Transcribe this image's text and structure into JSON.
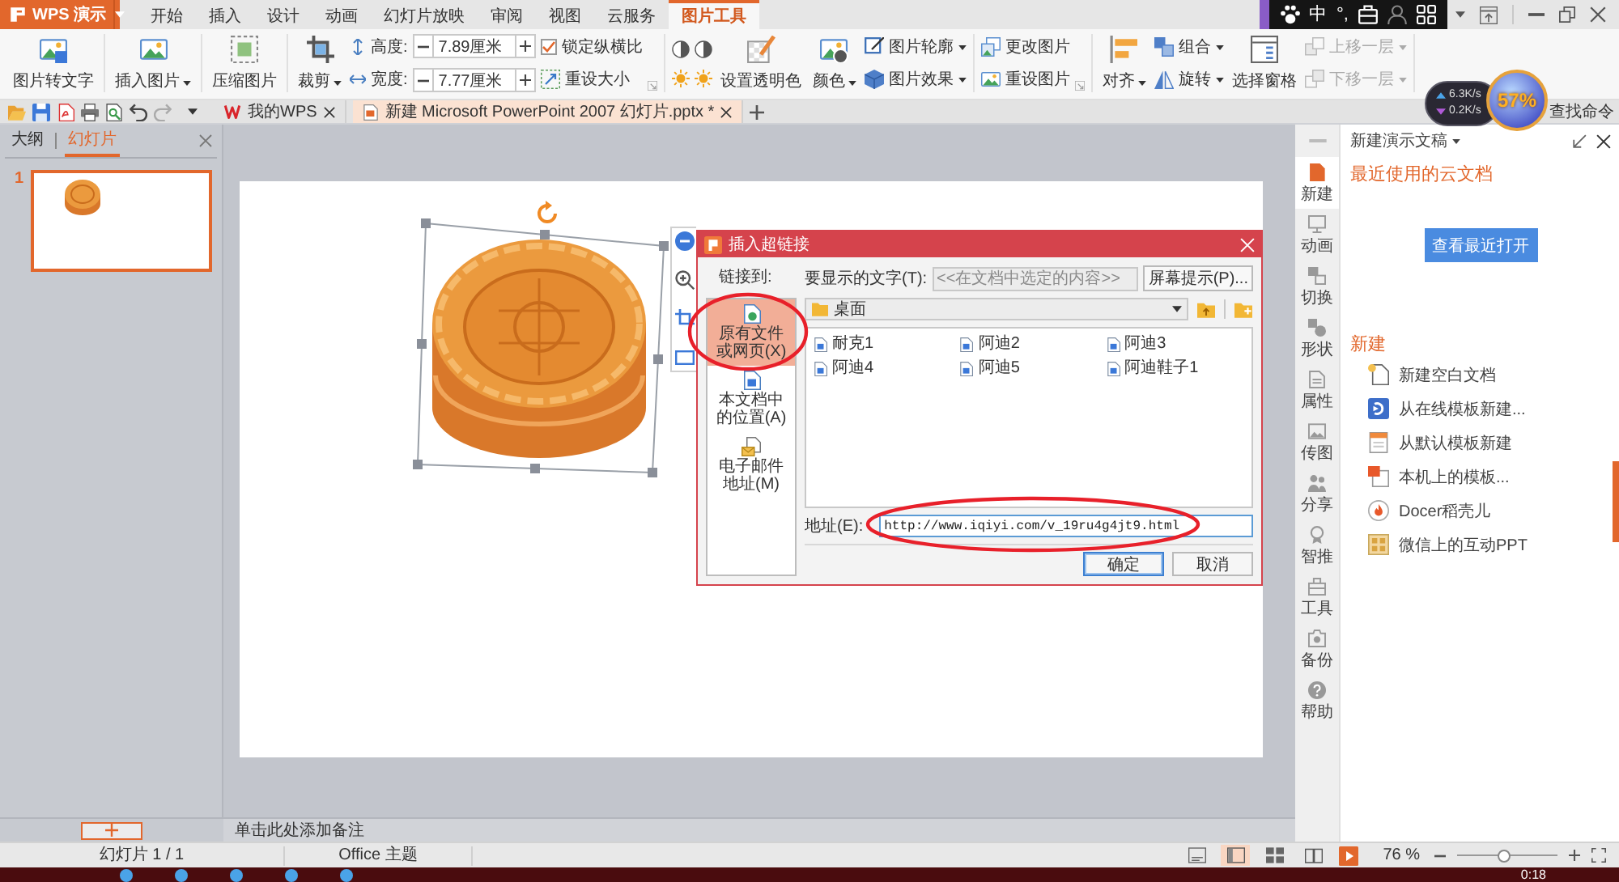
{
  "app_menu": {
    "label": "WPS 演示"
  },
  "tabs": [
    {
      "label": "开始",
      "selected": false
    },
    {
      "label": "插入",
      "selected": false
    },
    {
      "label": "设计",
      "selected": false
    },
    {
      "label": "动画",
      "selected": false
    },
    {
      "label": "幻灯片放映",
      "selected": false
    },
    {
      "label": "审阅",
      "selected": false
    },
    {
      "label": "视图",
      "selected": false
    },
    {
      "label": "云服务",
      "selected": false
    },
    {
      "label": "图片工具",
      "selected": true
    }
  ],
  "ime_bar": {
    "mode": "中",
    "punctuation": "°,"
  },
  "ribbon": {
    "picture_to_text": {
      "label": "图片转文字"
    },
    "insert_picture": {
      "label": "插入图片"
    },
    "compress_picture": {
      "label": "压缩图片"
    },
    "crop": {
      "label": "裁剪"
    },
    "height": {
      "label": "高度:",
      "value": "7.89厘米"
    },
    "width": {
      "label": "宽度:",
      "value": "7.77厘米"
    },
    "lock_ratio": {
      "label": "锁定纵横比",
      "checked": true
    },
    "reset_size": {
      "label": "重设大小"
    },
    "set_transparent_color": {
      "label": "设置透明色"
    },
    "color": {
      "label": "颜色"
    },
    "picture_outline": {
      "label": "图片轮廓"
    },
    "picture_effects": {
      "label": "图片效果"
    },
    "change_picture": {
      "label": "更改图片"
    },
    "reset_picture": {
      "label": "重设图片"
    },
    "align": {
      "label": "对齐"
    },
    "group": {
      "label": "组合"
    },
    "rotate": {
      "label": "旋转"
    },
    "selection_pane": {
      "label": "选择窗格"
    },
    "bring_forward": {
      "label": "上移一层",
      "disabled": true
    },
    "send_backward": {
      "label": "下移一层",
      "disabled": true
    }
  },
  "doc_tabs": [
    {
      "label": "我的WPS",
      "selected": false
    },
    {
      "label": "新建 Microsoft PowerPoint 2007 幻灯片.pptx *",
      "selected": true
    }
  ],
  "find_command": "查找命令",
  "speed_widget": {
    "upload": "6.3K/s",
    "download": "0.2K/s",
    "percent": "57%"
  },
  "left_panel": {
    "tabs": [
      {
        "label": "大纲",
        "selected": false
      },
      {
        "label": "幻灯片",
        "selected": true
      }
    ],
    "slides": [
      {
        "number": "1",
        "selected": true
      }
    ]
  },
  "dialog": {
    "title": "插入超链接",
    "link_to_label": "链接到:",
    "link_targets": [
      {
        "label": "原有文件或网页(X)",
        "selected": true
      },
      {
        "label": "本文档中的位置(A)",
        "selected": false
      },
      {
        "label": "电子邮件地址(M)",
        "selected": false
      }
    ],
    "display_text": {
      "label": "要显示的文字(T):",
      "placeholder": "<<在文档中选定的内容>>",
      "disabled": true
    },
    "screen_tip_button": {
      "label": "屏幕提示(P)..."
    },
    "folder": {
      "value": "桌面"
    },
    "files": [
      {
        "name": "耐克1"
      },
      {
        "name": "阿迪2"
      },
      {
        "name": "阿迪3"
      },
      {
        "name": "阿迪4"
      },
      {
        "name": "阿迪5"
      },
      {
        "name": "阿迪鞋子1"
      }
    ],
    "address": {
      "label": "地址(E):",
      "value": "http://www.iqiyi.com/v_19ru4g4jt9.html"
    },
    "buttons": [
      {
        "label": "确定",
        "focused": true
      },
      {
        "label": "取消",
        "focused": false
      }
    ]
  },
  "notes": {
    "placeholder": "单击此处添加备注"
  },
  "right_panel": {
    "title": "新建演示文稿",
    "sidebar": [
      {
        "label": "新建",
        "selected": true
      },
      {
        "label": "动画",
        "selected": false
      },
      {
        "label": "切换",
        "selected": false
      },
      {
        "label": "形状",
        "selected": false
      },
      {
        "label": "属性",
        "selected": false
      },
      {
        "label": "传图",
        "selected": false
      },
      {
        "label": "分享",
        "selected": false
      },
      {
        "label": "智推",
        "selected": false
      },
      {
        "label": "工具",
        "selected": false
      },
      {
        "label": "备份",
        "selected": false
      },
      {
        "label": "帮助",
        "selected": false
      }
    ],
    "recent_heading": "最近使用的云文档",
    "recent_button": "查看最近打开",
    "new_heading": "新建",
    "new_items": [
      "新建空白文档",
      "从在线模板新建...",
      "从默认模板新建",
      "本机上的模板...",
      "Docer稻壳儿",
      "微信上的互动PPT"
    ]
  },
  "status_bar": {
    "slide_info": "幻灯片 1 / 1",
    "theme": "Office 主题",
    "views": [
      {
        "kind": "notes",
        "selected": false
      },
      {
        "kind": "normal",
        "selected": true
      },
      {
        "kind": "sorter",
        "selected": false
      },
      {
        "kind": "reading",
        "selected": false
      }
    ],
    "zoom": "76 %",
    "zoom_slider": {
      "level": 0.47
    }
  },
  "taskbar": {
    "clock": "0:18"
  }
}
